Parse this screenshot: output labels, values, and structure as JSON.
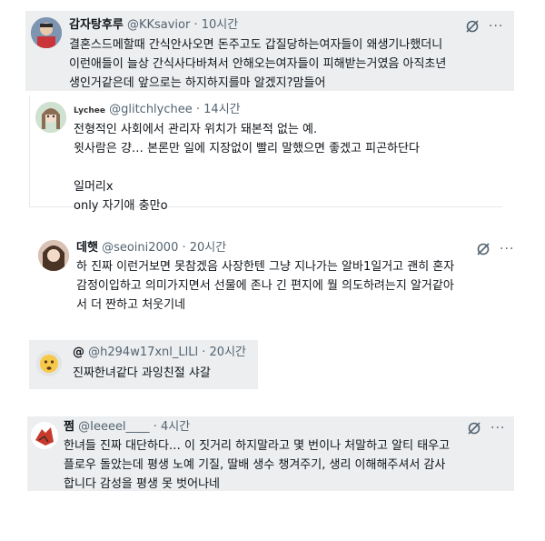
{
  "posts": [
    {
      "name": "감자탕후루",
      "handle": "@KKsavior",
      "time": "· 10시간",
      "text": "결혼스드메할때 간식안사오면 돈주고도 갑질당하는여자들이 왜생기나했더니\n이런애들이 늘상 간식사다바쳐서 안해오는여자들이 피해받는거였음 아직초년\n생인거같은데 앞으로는 하지하지를마 알겠지?맘들어"
    },
    {
      "badge": "Lychee",
      "handle": "@glitchlychee",
      "time": "· 14시간",
      "text": "전형적인 사회에서 관리자 위치가 돼본적 없는 예.\n윗사람은 걍… 본론만 일에 지장없이 빨리 말했으면 좋겠고 피곤하단다\n\n일머리x\nonly 자기애 충만o"
    },
    {
      "name": "데햇",
      "handle": "@seoini2000",
      "time": "· 20시간",
      "text": "하 진짜 이런거보면 못참겠음 사장한텐 그냥 지나가는 알바1일거고 괜히 혼자\n감정이입하고 의미가지면서 선물에 존나 긴 편지에 뭘 의도하려는지 알거같아\n서 더 짠하고 처웃기네"
    },
    {
      "name": "@",
      "handle": "@h294w17xnl_LlLl",
      "time": "· 20시간",
      "text": "진짜한녀같다  과잉친절 샤갈"
    },
    {
      "name": "쩜",
      "handle": "@Ieeeel____",
      "time": "· 4시간",
      "text": "한녀들 진짜 대단하다… 이 짓거리 하지말라고 몇 번이나 처말하고 알티 태우고\n플로우 돌았는데 평생 노예 기질, 딸배 생수 챙겨주기, 생리 이해해주셔서 감사\n합니다 감성을 평생 못 벗어나네"
    }
  ],
  "icons": {
    "mute": "mute-icon",
    "more": "···"
  }
}
